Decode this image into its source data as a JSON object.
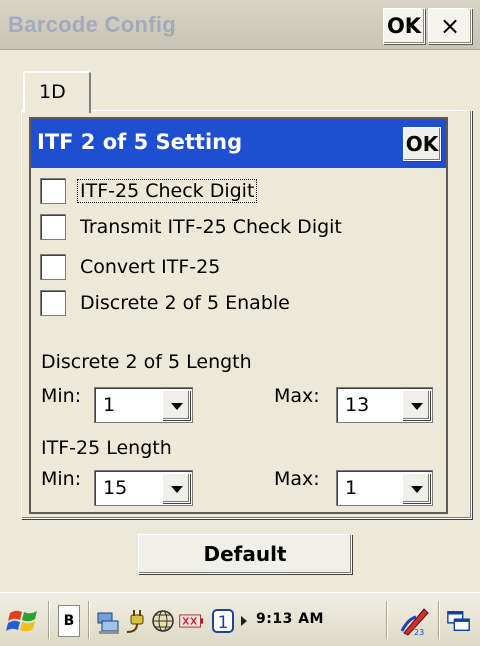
{
  "window": {
    "title": "Barcode Config",
    "ok_label": "OK",
    "close_label": "×"
  },
  "tabs": [
    {
      "label": "1D",
      "selected": true
    }
  ],
  "dialog": {
    "title": "ITF 2 of 5 Setting",
    "ok_label": "OK",
    "checkboxes": [
      {
        "label": "ITF-25 Check Digit",
        "checked": false,
        "focused": true
      },
      {
        "label": "Transmit ITF-25 Check Digit",
        "checked": false
      },
      {
        "label": "Convert ITF-25",
        "checked": false
      },
      {
        "label": "Discrete 2 of 5 Enable",
        "checked": false
      }
    ],
    "discrete_length": {
      "label": "Discrete 2 of 5 Length",
      "min_label": "Min:",
      "min_value": "1",
      "max_label": "Max:",
      "max_value": "13"
    },
    "itf_length": {
      "label": "ITF-25 Length",
      "min_label": "Min:",
      "min_value": "15",
      "max_label": "Max:",
      "max_value": "1"
    }
  },
  "default_button": "Default",
  "taskbar": {
    "input_button": "B",
    "clock": "9:13 AM",
    "icons": [
      "windows-start-icon",
      "network-icon",
      "power-plug-icon",
      "globe-icon",
      "battery-icon",
      "number-one-icon",
      "arrow-right-icon",
      "pen-input-icon",
      "window-switch-icon"
    ]
  }
}
